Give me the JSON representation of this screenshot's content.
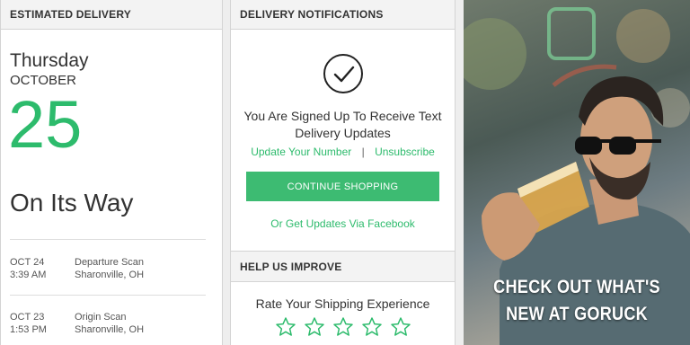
{
  "estimated_delivery": {
    "header": "ESTIMATED DELIVERY",
    "weekday": "Thursday",
    "month": "OCTOBER",
    "day": "25",
    "status": "On Its Way",
    "scans": [
      {
        "date": "OCT 24",
        "time": "3:39 AM",
        "event": "Departure Scan",
        "location": "Sharonville, OH"
      },
      {
        "date": "OCT 23",
        "time": "1:53 PM",
        "event": "Origin Scan",
        "location": "Sharonville, OH"
      }
    ]
  },
  "notifications": {
    "header": "DELIVERY NOTIFICATIONS",
    "icon": "checkmark-circle-icon",
    "message": "You Are Signed Up To Receive Text Delivery Updates",
    "update_number": "Update Your Number",
    "separator": "|",
    "unsubscribe": "Unsubscribe",
    "cta": "CONTINUE SHOPPING",
    "facebook": "Or Get Updates Via Facebook"
  },
  "help": {
    "header": "HELP US IMPROVE",
    "rate_label": "Rate Your Shipping Experience",
    "star_count": 5
  },
  "promo": {
    "line1": "CHECK OUT WHAT'S",
    "line2": "NEW AT GORUCK"
  },
  "colors": {
    "accent": "#2dbb6c",
    "button": "#3dbb72",
    "header_bg": "#f3f3f3"
  }
}
